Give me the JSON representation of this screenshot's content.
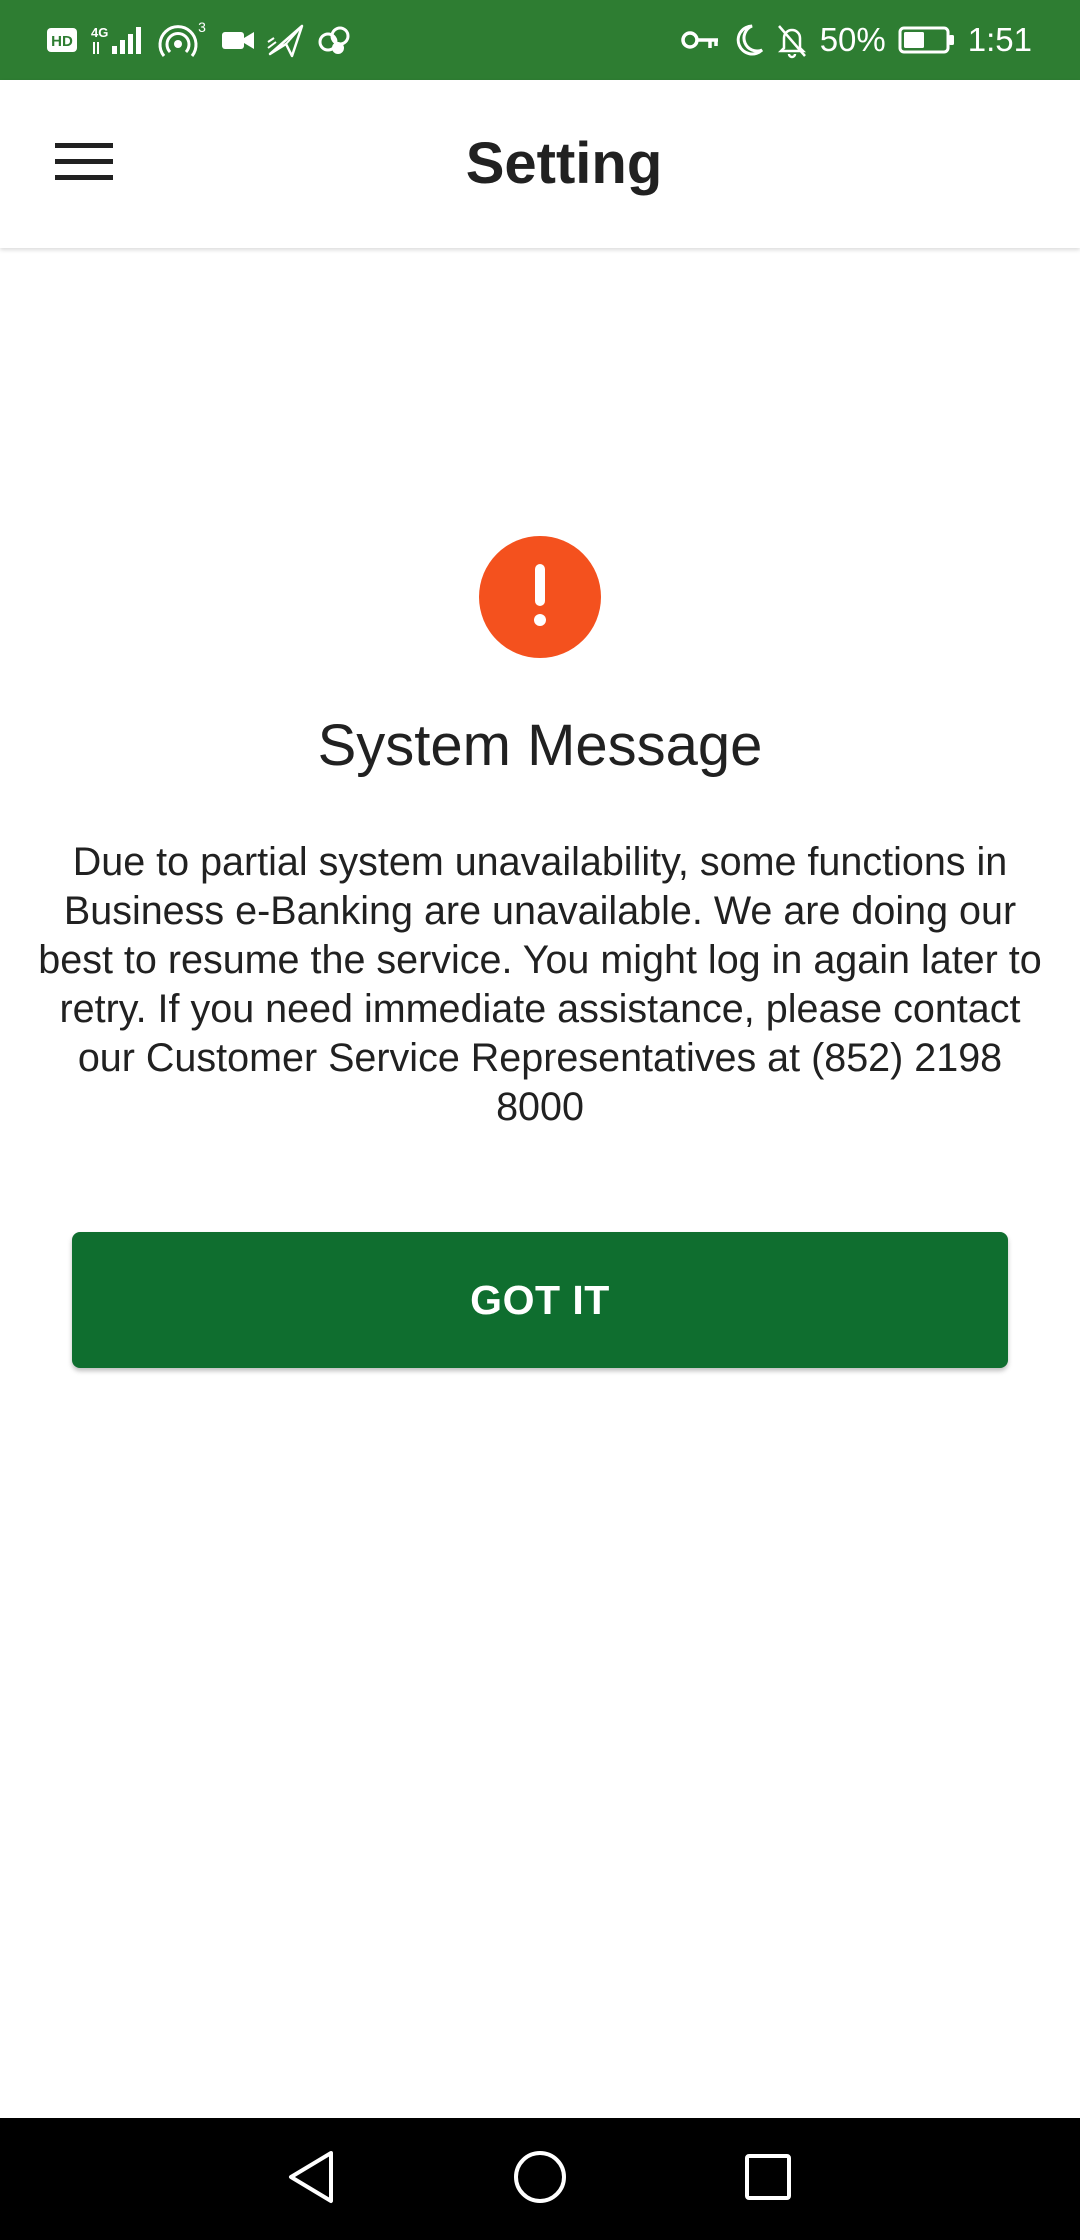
{
  "status_bar": {
    "background": "#2e7d32",
    "left_icons": [
      "hd-icon",
      "4g-signal-icon",
      "hotspot-icon",
      "video-camera-icon",
      "paper-plane-icon",
      "cloud-sync-icon"
    ],
    "hotspot_count": "3",
    "network_label": "4G",
    "hd_label": "HD",
    "right_icons": [
      "vpn-key-icon",
      "moon-icon",
      "bell-off-icon",
      "battery-icon"
    ],
    "battery_percent": "50%",
    "battery_level": 0.5,
    "time": "1:51"
  },
  "app_bar": {
    "menu_icon": "hamburger-menu-icon",
    "title": "Setting"
  },
  "dialog": {
    "icon": "exclamation-icon",
    "icon_color": "#f4511e",
    "title": "System Message",
    "message": "Due to partial system unavailability, some functions in Business e-Banking are unavailable. We are doing our best to resume the service. You might log in again later to retry. If you need immediate assistance, please contact our Customer Service Representatives at (852) 2198 8000",
    "button_label": "GOT IT",
    "button_color": "#0f6e2f"
  },
  "nav_bar": {
    "buttons": [
      "back-triangle-icon",
      "home-circle-icon",
      "recents-square-icon"
    ]
  }
}
